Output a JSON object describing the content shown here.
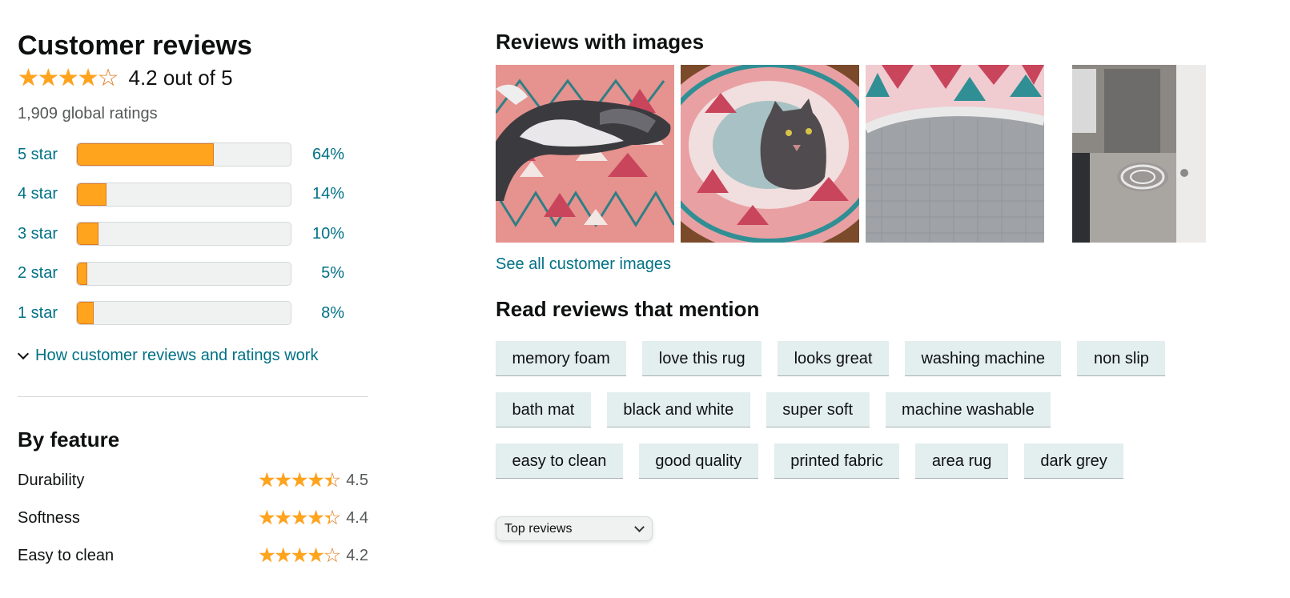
{
  "reviews": {
    "title": "Customer reviews",
    "overall_rating": 4.2,
    "overall_text": "4.2 out of 5",
    "global_ratings": "1,909 global ratings"
  },
  "histogram": [
    {
      "label": "5 star",
      "percent": 64,
      "percent_text": "64%"
    },
    {
      "label": "4 star",
      "percent": 14,
      "percent_text": "14%"
    },
    {
      "label": "3 star",
      "percent": 10,
      "percent_text": "10%"
    },
    {
      "label": "2 star",
      "percent": 5,
      "percent_text": "5%"
    },
    {
      "label": "1 star",
      "percent": 8,
      "percent_text": "8%"
    }
  ],
  "how_link": "How customer reviews and ratings work",
  "by_feature": {
    "title": "By feature",
    "items": [
      {
        "name": "Durability",
        "rating": 4.5,
        "value_text": "4.5"
      },
      {
        "name": "Softness",
        "rating": 4.4,
        "value_text": "4.4"
      },
      {
        "name": "Easy to clean",
        "rating": 4.2,
        "value_text": "4.2"
      }
    ]
  },
  "images_section": {
    "title": "Reviews with images",
    "see_all": "See all customer images",
    "images": [
      {
        "name": "review-image-cat-on-rug"
      },
      {
        "name": "review-image-cat-sitting-on-round-rug"
      },
      {
        "name": "review-image-rug-backing"
      },
      {
        "name": "review-image-bathroom-rug"
      }
    ]
  },
  "mentions": {
    "title": "Read reviews that mention",
    "rows": [
      [
        "memory foam",
        "love this rug",
        "looks great",
        "washing machine",
        "non slip"
      ],
      [
        "bath mat",
        "black and white",
        "super soft",
        "machine washable"
      ],
      [
        "easy to clean",
        "good quality",
        "printed fabric",
        "area rug",
        "dark grey"
      ]
    ]
  },
  "sort": {
    "selected": "Top reviews"
  },
  "colors": {
    "link": "#007185",
    "star": "#ffa41c",
    "chip_bg": "#e3eeee"
  }
}
